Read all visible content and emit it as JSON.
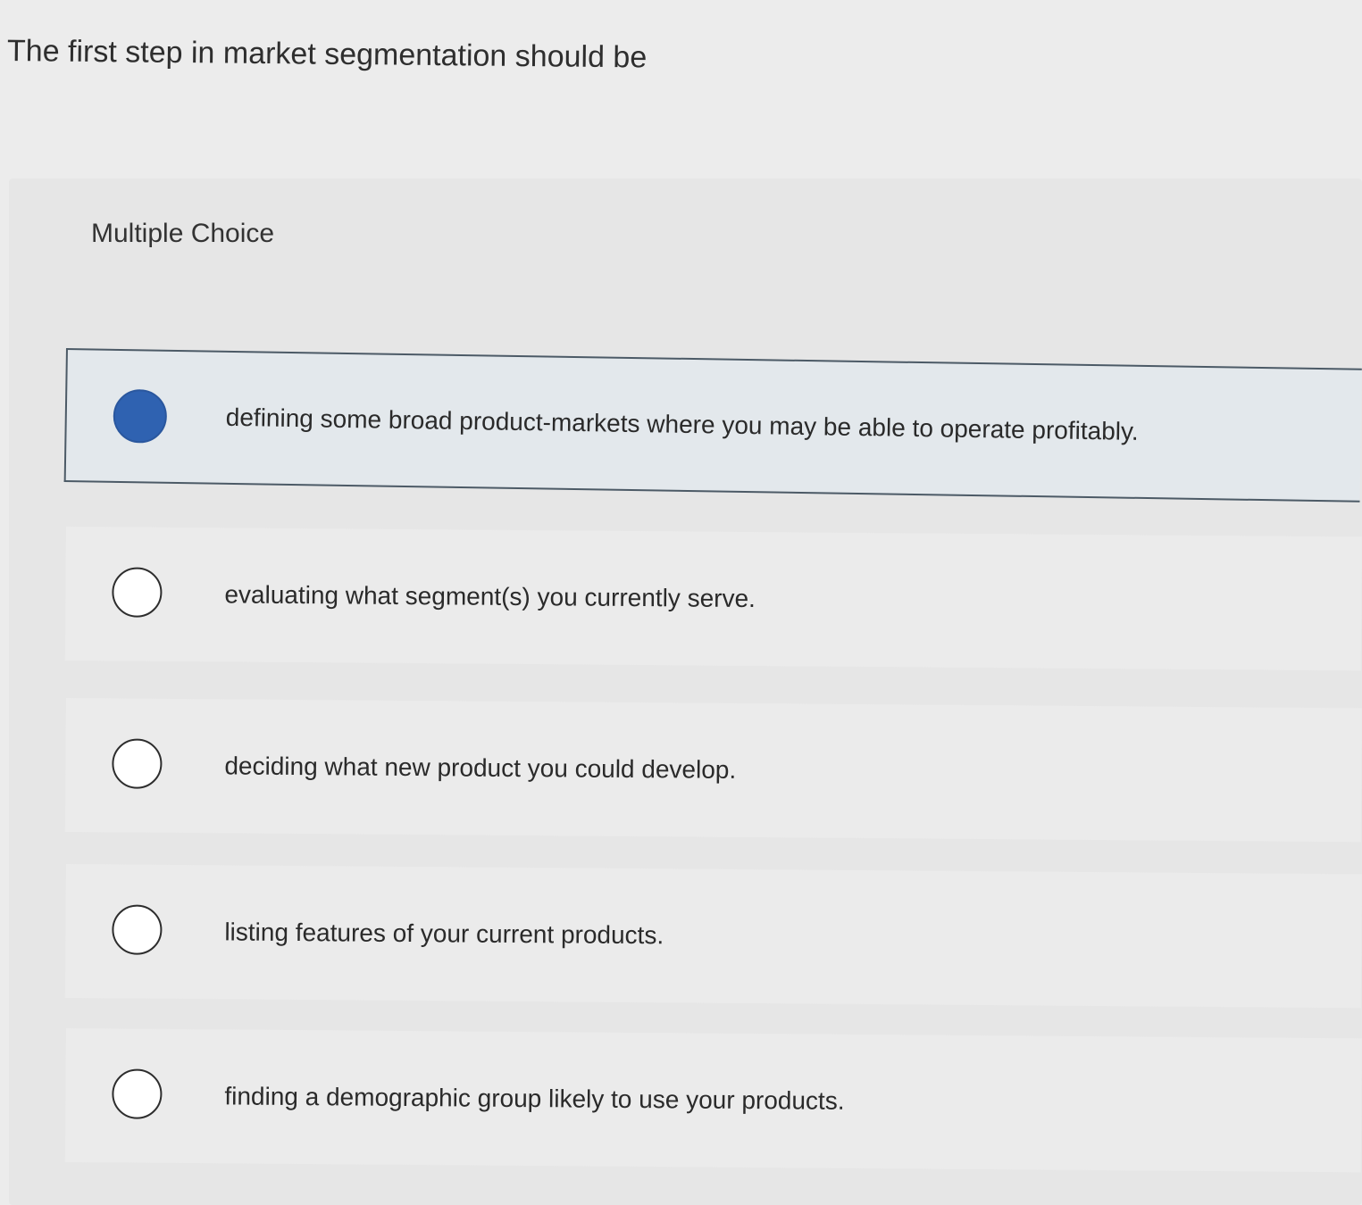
{
  "question": {
    "text": "The first step in market segmentation should be"
  },
  "choice_block": {
    "type_label": "Multiple Choice",
    "options": [
      {
        "label": "defining some broad product-markets where you may be able to operate profitably.",
        "selected": true
      },
      {
        "label": "evaluating what segment(s) you currently serve.",
        "selected": false
      },
      {
        "label": "deciding what new product you could develop.",
        "selected": false
      },
      {
        "label": "listing features of your current products.",
        "selected": false
      },
      {
        "label": "finding a demographic group likely to use your products.",
        "selected": false
      }
    ]
  },
  "colors": {
    "selected_radio": "#2f62b1",
    "selected_background": "#e3e8ec",
    "selected_border": "#4c5a66",
    "page_background": "#ececec"
  }
}
